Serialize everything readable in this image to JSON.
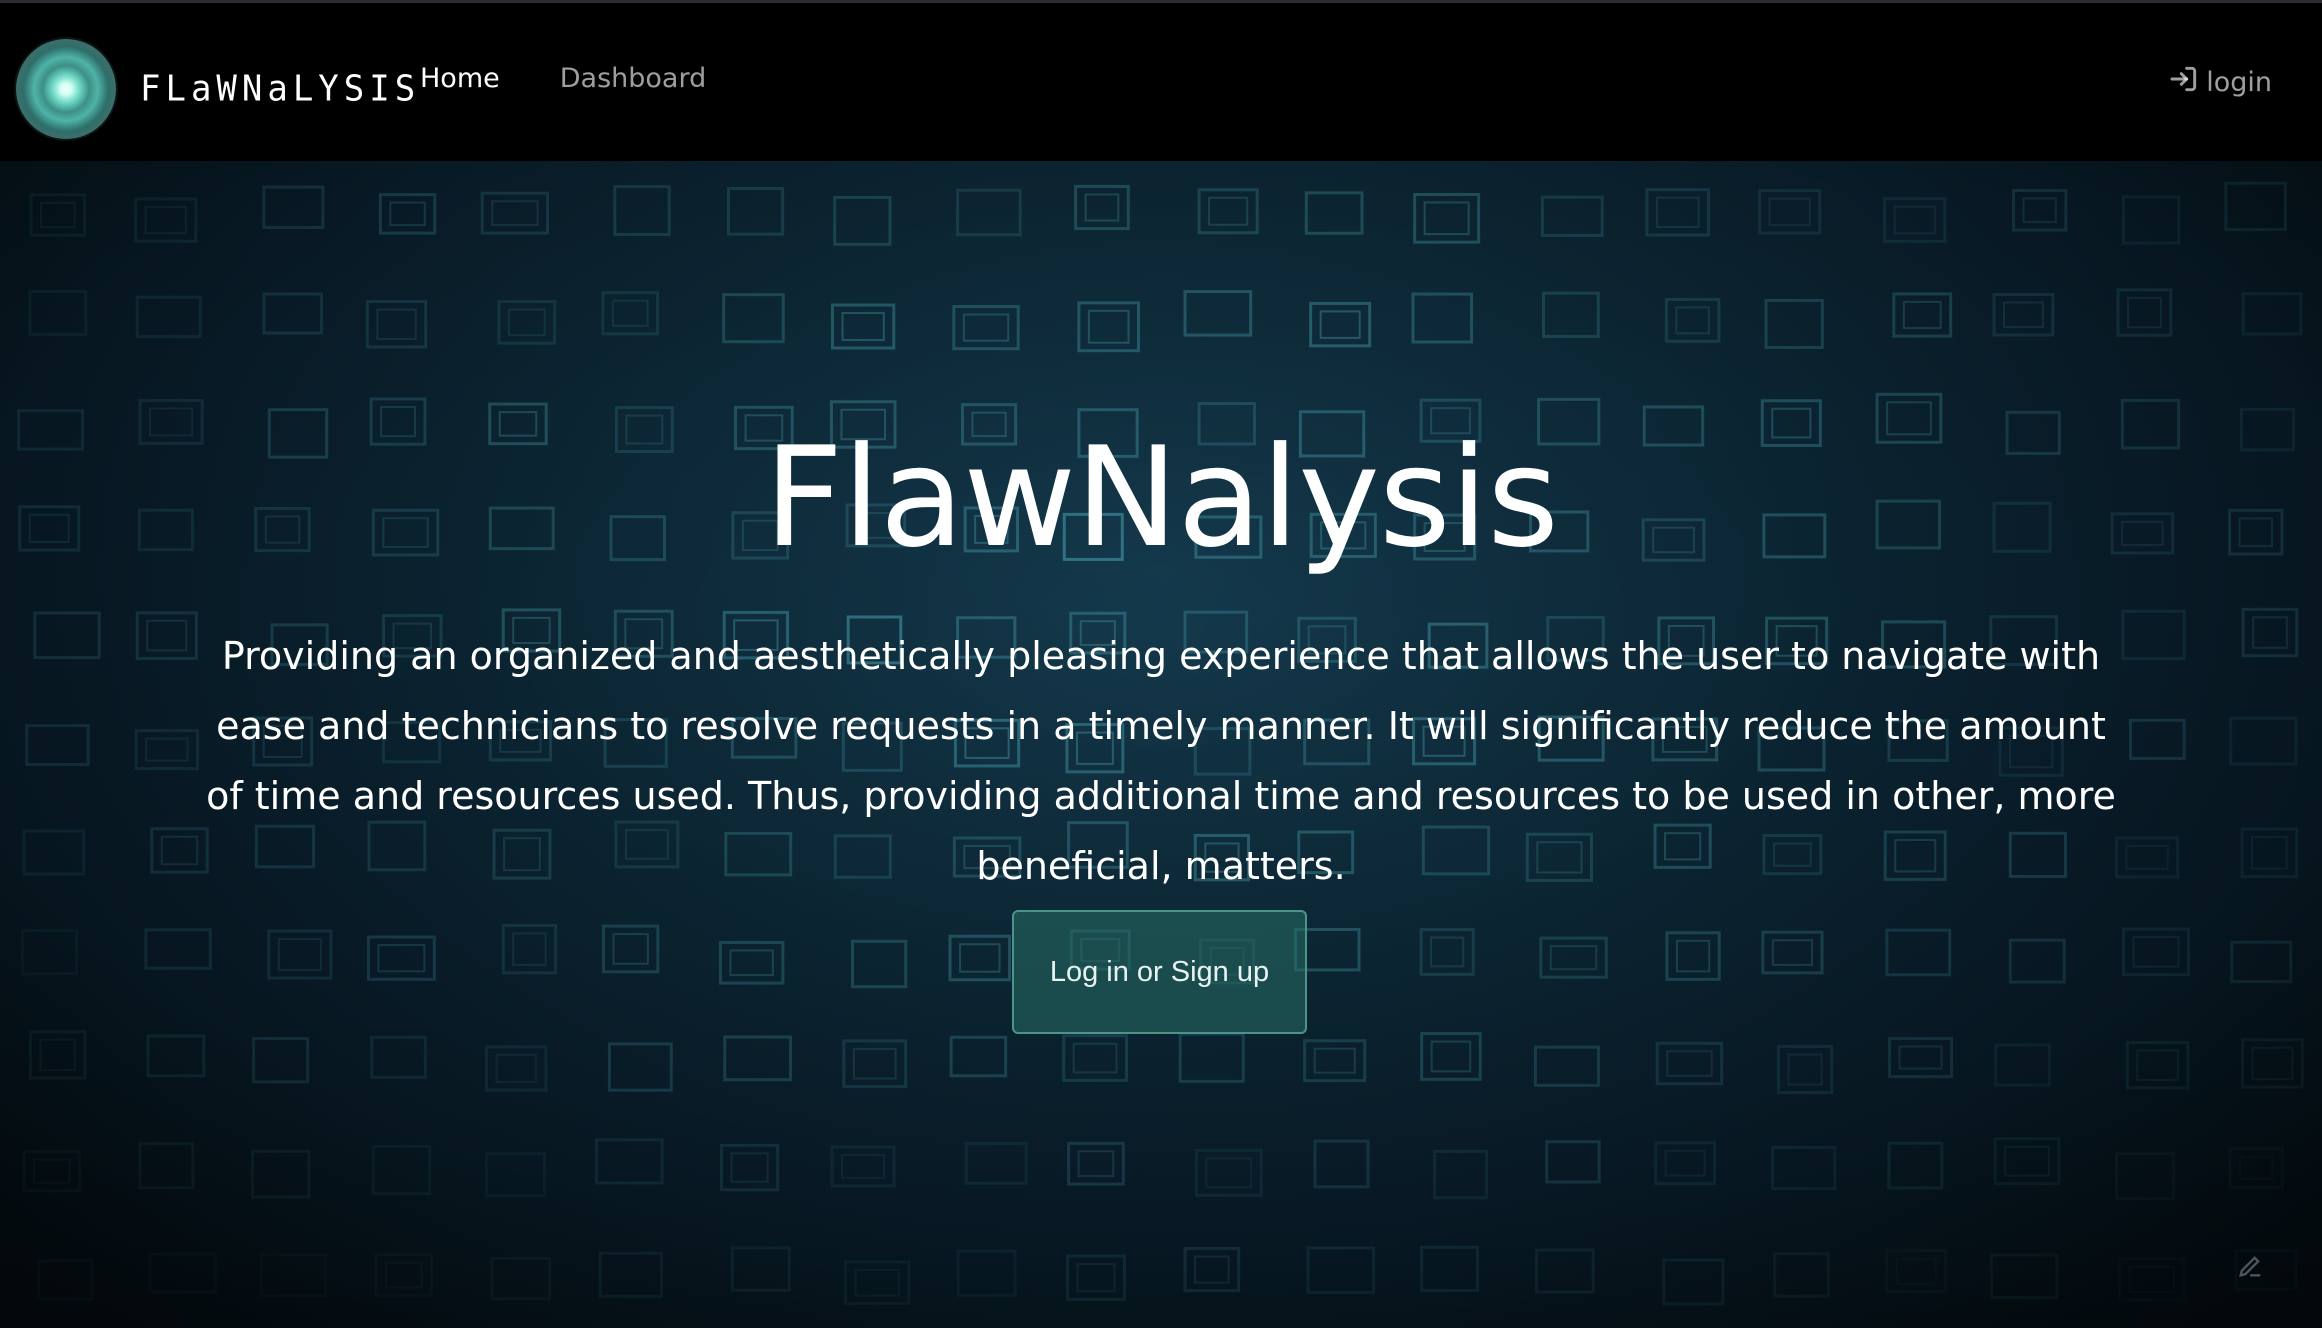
{
  "navbar": {
    "brand_text": "FLaWNaLYSIS",
    "links": [
      {
        "label": "Home",
        "active": true
      },
      {
        "label": "Dashboard",
        "active": false
      }
    ],
    "login_label": "login",
    "login_icon": "sign-in-icon"
  },
  "hero": {
    "title": "FlawNalysis",
    "description": "Providing an organized and aesthetically pleasing experience that allows the user to navigate with ease and technicians to resolve requests in a timely manner. It will significantly reduce the amount of time and resources used. Thus, providing additional time and resources to be used in other, more beneficial, matters.",
    "cta_label": "Log in or Sign up",
    "background_style": "glowing rectangle grid"
  },
  "colors": {
    "navbar_bg": "#000000",
    "hero_bg": "#0e2c3c",
    "accent": "#4a9488",
    "text": "#ffffff"
  }
}
